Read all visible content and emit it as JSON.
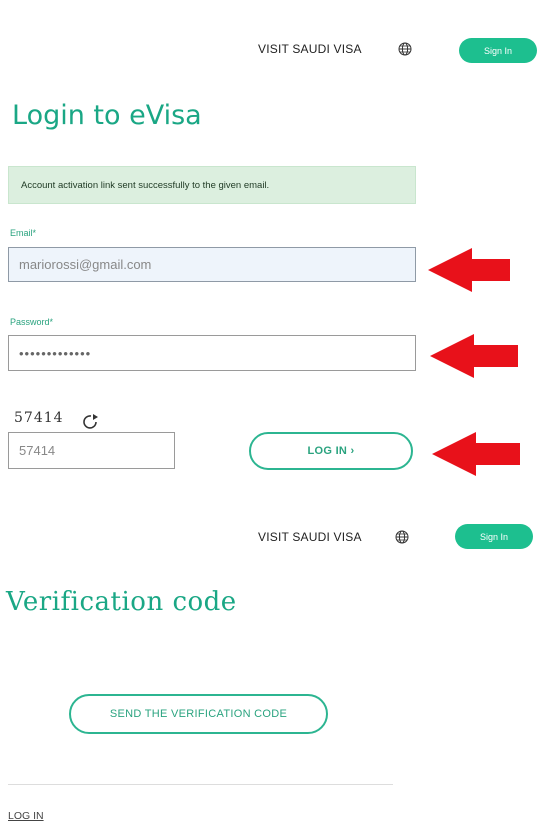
{
  "header1": {
    "visit_link": "VISIT SAUDI VISA",
    "globe_icon": "globe-icon",
    "signin_label": "Sign In"
  },
  "login": {
    "title": "Login to eVisa",
    "alert_message": "Account activation link sent successfully to the given email.",
    "email_label": "Email*",
    "email_value": "mariorossi@gmail.com",
    "password_label": "Password*",
    "password_value": "•••••••••••••",
    "captcha_text": "57414",
    "captcha_input_value": "57414",
    "login_button": "LOG IN ›",
    "refresh_icon": "refresh-icon"
  },
  "header2": {
    "visit_link": "VISIT SAUDI VISA",
    "globe_icon": "globe-icon",
    "signin_label": "Sign In"
  },
  "verification": {
    "title": "Verification code",
    "send_button": "SEND THE VERIFICATION CODE",
    "login_link": "LOG IN"
  },
  "annotations": {
    "arrow_color": "#e8111a",
    "arrow_icon": "red-arrow-left-icon"
  },
  "colors": {
    "accent": "#1dbf8f",
    "title": "#1aa785"
  }
}
